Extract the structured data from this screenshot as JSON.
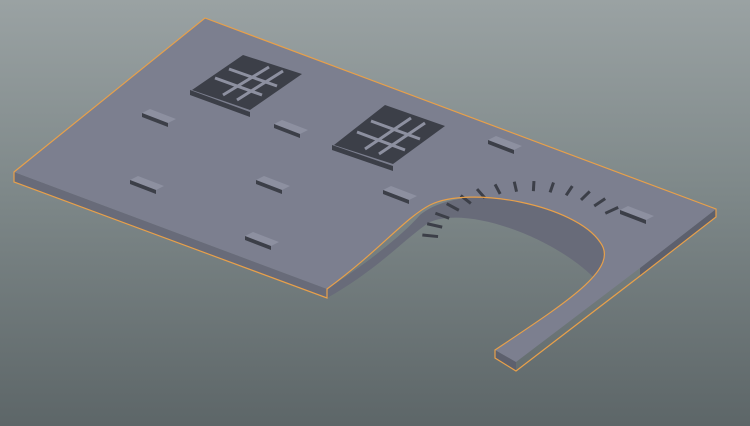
{
  "viewport": {
    "background_top": "#9aa2a3",
    "background_bottom": "#5d6668"
  },
  "selected_object": {
    "wire_color": "#e8a04a",
    "top_face_color": "#7c7f8f",
    "front_face_color": "#686b79",
    "side_face_color": "#5d606d",
    "recess_color": "#3c3f48",
    "relief_color": "#8d90a0"
  }
}
